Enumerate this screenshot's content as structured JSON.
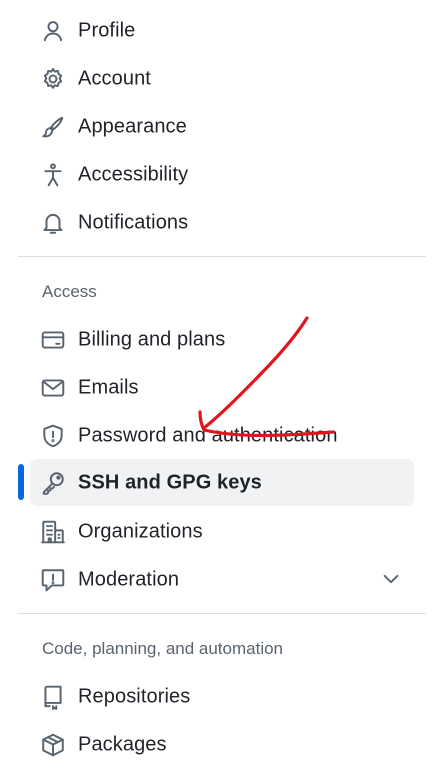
{
  "sidebar": {
    "top_items": [
      {
        "label": "Profile",
        "icon": "person-icon"
      },
      {
        "label": "Account",
        "icon": "gear-icon"
      },
      {
        "label": "Appearance",
        "icon": "paintbrush-icon"
      },
      {
        "label": "Accessibility",
        "icon": "accessibility-icon"
      },
      {
        "label": "Notifications",
        "icon": "bell-icon"
      }
    ],
    "access": {
      "heading": "Access",
      "items": [
        {
          "label": "Billing and plans",
          "icon": "credit-card-icon"
        },
        {
          "label": "Emails",
          "icon": "mail-icon"
        },
        {
          "label": "Password and authentication",
          "icon": "shield-icon"
        },
        {
          "label": "SSH and GPG keys",
          "icon": "key-icon",
          "active": true
        },
        {
          "label": "Organizations",
          "icon": "organization-icon"
        },
        {
          "label": "Moderation",
          "icon": "report-icon",
          "expandable": true
        }
      ]
    },
    "code": {
      "heading": "Code, planning, and automation",
      "items": [
        {
          "label": "Repositories",
          "icon": "repo-icon"
        },
        {
          "label": "Packages",
          "icon": "package-icon"
        }
      ]
    }
  },
  "colors": {
    "active_indicator": "#0969da",
    "active_background": "#f1f2f4",
    "annotation_arrow": "#e0161e"
  }
}
